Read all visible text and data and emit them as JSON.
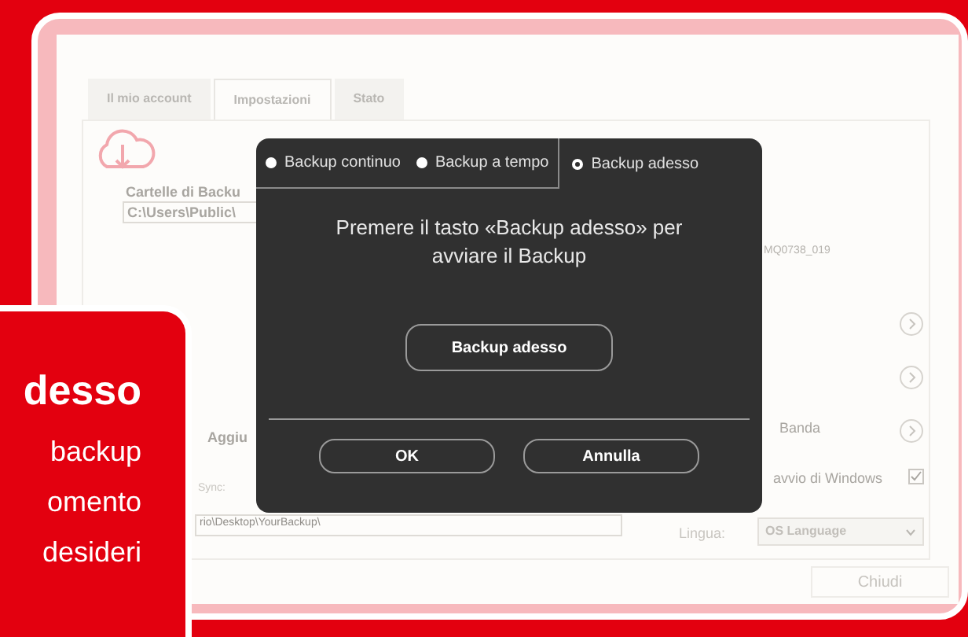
{
  "window": {
    "tabs": [
      {
        "label": "Il mio account",
        "selected": false
      },
      {
        "label": "Impostazioni",
        "selected": true
      },
      {
        "label": "Stato",
        "selected": false
      }
    ],
    "folders_label": "Cartelle di Backu",
    "folder_path": "C:\\Users\\Public\\",
    "add_button": "Aggiu",
    "sync_label": "Sync:",
    "sync_path": "rio\\Desktop\\YourBackup\\",
    "device_id": "MQ0738_019",
    "settings_rows": [
      {
        "label": "Banda"
      }
    ],
    "startup": {
      "label": "avvio di Windows",
      "checked": true
    },
    "language": {
      "label": "Lingua:",
      "value": "OS Language"
    },
    "close_button": "Chiudi"
  },
  "dialog": {
    "modes": [
      {
        "label": "Backup continuo",
        "selected": false
      },
      {
        "label": "Backup a tempo",
        "selected": false
      },
      {
        "label": "Backup adesso",
        "selected": true
      }
    ],
    "message": "Premere il tasto «Backup adesso» per avviare il Backup",
    "action_button": "Backup adesso",
    "buttons": [
      "OK",
      "Annulla"
    ]
  },
  "promo": {
    "heading": "desso",
    "lines": [
      "backup",
      "omento",
      "desideri"
    ]
  }
}
